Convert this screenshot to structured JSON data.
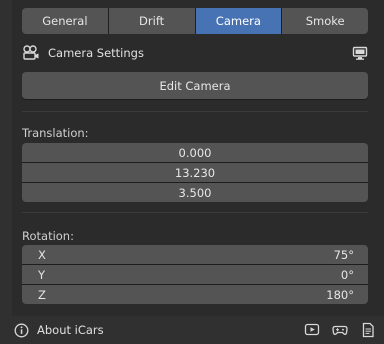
{
  "tabs": [
    {
      "label": "General",
      "active": false
    },
    {
      "label": "Drift",
      "active": false
    },
    {
      "label": "Camera",
      "active": true
    },
    {
      "label": "Smoke",
      "active": false
    }
  ],
  "camera_section": {
    "title": "Camera Settings",
    "icon": "camera-settings-icon",
    "right_icon": "monitor-icon"
  },
  "edit_button": "Edit Camera",
  "translation": {
    "label": "Translation:",
    "values": [
      "0.000",
      "13.230",
      "3.500"
    ]
  },
  "rotation": {
    "label": "Rotation:",
    "rows": [
      {
        "axis": "X",
        "value": "75°"
      },
      {
        "axis": "Y",
        "value": "0°"
      },
      {
        "axis": "Z",
        "value": "180°"
      }
    ]
  },
  "footer": {
    "title": "About iCars",
    "icons": [
      "info-icon",
      "video-icon",
      "gamepad-icon",
      "document-icon"
    ]
  },
  "colors": {
    "accent": "#4772b3",
    "background": "#303030",
    "field": "#545454"
  }
}
